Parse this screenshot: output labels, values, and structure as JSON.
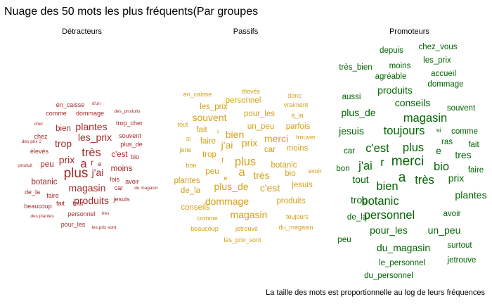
{
  "chart_data": {
    "type": "wordcloud",
    "title": "Nuage des 50 mots les plus fréquents(Par groupes",
    "caption": "La taille des mots est proportionnelle au log de leurs fréquences",
    "groups": [
      {
        "name": "Détracteurs",
        "color": "#a52a2a",
        "words": [
          {
            "text": "en_caisse",
            "weight": 2
          },
          {
            "text": "d'un",
            "weight": 1
          },
          {
            "text": "comme",
            "weight": 2
          },
          {
            "text": "dommage",
            "weight": 2
          },
          {
            "text": "des_produits",
            "weight": 1
          },
          {
            "text": "cher",
            "weight": 1
          },
          {
            "text": "plantes",
            "weight": 4
          },
          {
            "text": "trop_cher",
            "weight": 2
          },
          {
            "text": "bien",
            "weight": 3
          },
          {
            "text": "les_prix",
            "weight": 4
          },
          {
            "text": "chez",
            "weight": 2
          },
          {
            "text": "des prix 2",
            "weight": 1
          },
          {
            "text": "trop",
            "weight": 4
          },
          {
            "text": "souvent",
            "weight": 2
          },
          {
            "text": "plus_de",
            "weight": 2
          },
          {
            "text": "élevés",
            "weight": 2
          },
          {
            "text": "très",
            "weight": 5
          },
          {
            "text": "c'est",
            "weight": 3
          },
          {
            "text": "bio",
            "weight": 2
          },
          {
            "text": "prix",
            "weight": 4
          },
          {
            "text": "produit",
            "weight": 1
          },
          {
            "text": "peu",
            "weight": 3
          },
          {
            "text": "a",
            "weight": 5
          },
          {
            "text": "r",
            "weight": 3
          },
          {
            "text": "e",
            "weight": 2
          },
          {
            "text": "moins",
            "weight": 3
          },
          {
            "text": "plus",
            "weight": 6
          },
          {
            "text": "j'ai",
            "weight": 4
          },
          {
            "text": "fois",
            "weight": 2
          },
          {
            "text": "botanic",
            "weight": 3
          },
          {
            "text": "avoir",
            "weight": 2
          },
          {
            "text": "magasin",
            "weight": 4
          },
          {
            "text": "car",
            "weight": 2
          },
          {
            "text": "du magasin",
            "weight": 1
          },
          {
            "text": "de_la",
            "weight": 2
          },
          {
            "text": "faire",
            "weight": 2
          },
          {
            "text": "jesuis",
            "weight": 2
          },
          {
            "text": "produits",
            "weight": 4
          },
          {
            "text": "beaucoup",
            "weight": 2
          },
          {
            "text": "fait",
            "weight": 2
          },
          {
            "text": "tout",
            "weight": 2
          },
          {
            "text": "personnel",
            "weight": 2
          },
          {
            "text": "des plantes",
            "weight": 1
          },
          {
            "text": "tres",
            "weight": 1
          },
          {
            "text": "pour_les",
            "weight": 2
          },
          {
            "text": "les prix sont",
            "weight": 1
          }
        ]
      },
      {
        "name": "Passifs",
        "color": "#d4a017",
        "words": [
          {
            "text": "en_caisse",
            "weight": 2
          },
          {
            "text": "élevés",
            "weight": 2
          },
          {
            "text": "personnel",
            "weight": 3
          },
          {
            "text": "donc",
            "weight": 2
          },
          {
            "text": "vraiment",
            "weight": 2
          },
          {
            "text": "les_prix",
            "weight": 3
          },
          {
            "text": "pour_les",
            "weight": 3
          },
          {
            "text": "à_la",
            "weight": 2
          },
          {
            "text": "souvent",
            "weight": 4
          },
          {
            "text": "tout",
            "weight": 2
          },
          {
            "text": "un_peu",
            "weight": 3
          },
          {
            "text": "parfois",
            "weight": 3
          },
          {
            "text": "fait",
            "weight": 3
          },
          {
            "text": "1",
            "weight": 1
          },
          {
            "text": "bien",
            "weight": 4
          },
          {
            "text": "trouver",
            "weight": 2
          },
          {
            "text": "si",
            "weight": 2
          },
          {
            "text": "faire",
            "weight": 3
          },
          {
            "text": "merci",
            "weight": 4
          },
          {
            "text": "j'ai",
            "weight": 4
          },
          {
            "text": "prix",
            "weight": 4
          },
          {
            "text": "jene",
            "weight": 2
          },
          {
            "text": "car",
            "weight": 3
          },
          {
            "text": "moins",
            "weight": 3
          },
          {
            "text": "trop",
            "weight": 3
          },
          {
            "text": "r",
            "weight": 3
          },
          {
            "text": "plus",
            "weight": 5
          },
          {
            "text": "bon",
            "weight": 2
          },
          {
            "text": "botanic",
            "weight": 3
          },
          {
            "text": "peu",
            "weight": 3
          },
          {
            "text": "a",
            "weight": 5
          },
          {
            "text": "très",
            "weight": 4
          },
          {
            "text": "bio",
            "weight": 3
          },
          {
            "text": "avoir",
            "weight": 2
          },
          {
            "text": "e",
            "weight": 2
          },
          {
            "text": "plantes",
            "weight": 3
          },
          {
            "text": "plus_de",
            "weight": 4
          },
          {
            "text": "c'est",
            "weight": 4
          },
          {
            "text": "jesuis",
            "weight": 3
          },
          {
            "text": "de_la",
            "weight": 3
          },
          {
            "text": "dommage",
            "weight": 4
          },
          {
            "text": "produits",
            "weight": 3
          },
          {
            "text": "conseils",
            "weight": 3
          },
          {
            "text": "magasin",
            "weight": 4
          },
          {
            "text": "comme",
            "weight": 2
          },
          {
            "text": "toujours",
            "weight": 2
          },
          {
            "text": "beaucoup",
            "weight": 2
          },
          {
            "text": "jetrouve",
            "weight": 2
          },
          {
            "text": "du_magasin",
            "weight": 2
          },
          {
            "text": "les_prix_sont",
            "weight": 2
          }
        ]
      },
      {
        "name": "Promoteurs",
        "color": "#006400",
        "words": [
          {
            "text": "depuis",
            "weight": 3
          },
          {
            "text": "chez_vous",
            "weight": 3
          },
          {
            "text": "les_prix",
            "weight": 3
          },
          {
            "text": "très_bien",
            "weight": 3
          },
          {
            "text": "moins",
            "weight": 3
          },
          {
            "text": "accueil",
            "weight": 3
          },
          {
            "text": "agréable",
            "weight": 3
          },
          {
            "text": "dommage",
            "weight": 3
          },
          {
            "text": "aussi",
            "weight": 3
          },
          {
            "text": "produits",
            "weight": 4
          },
          {
            "text": "conseils",
            "weight": 4
          },
          {
            "text": "souvent",
            "weight": 3
          },
          {
            "text": "plus_de",
            "weight": 4
          },
          {
            "text": "magasin",
            "weight": 5
          },
          {
            "text": "jesuis",
            "weight": 4
          },
          {
            "text": "toujours",
            "weight": 5
          },
          {
            "text": "si",
            "weight": 2
          },
          {
            "text": "comme",
            "weight": 3
          },
          {
            "text": "ras",
            "weight": 3
          },
          {
            "text": "fait",
            "weight": 3
          },
          {
            "text": "car",
            "weight": 3
          },
          {
            "text": "c'est",
            "weight": 5
          },
          {
            "text": "plus",
            "weight": 5
          },
          {
            "text": "e",
            "weight": 4
          },
          {
            "text": "tres",
            "weight": 4
          },
          {
            "text": "r",
            "weight": 5
          },
          {
            "text": "merci",
            "weight": 6
          },
          {
            "text": "bon",
            "weight": 3
          },
          {
            "text": "j'ai",
            "weight": 5
          },
          {
            "text": "bio",
            "weight": 5
          },
          {
            "text": "faire",
            "weight": 3
          },
          {
            "text": "prix",
            "weight": 4
          },
          {
            "text": "tout",
            "weight": 4
          },
          {
            "text": "a",
            "weight": 6
          },
          {
            "text": "très",
            "weight": 5
          },
          {
            "text": "bien",
            "weight": 5
          },
          {
            "text": "plantes",
            "weight": 4
          },
          {
            "text": "trop",
            "weight": 4
          },
          {
            "text": "botanic",
            "weight": 5
          },
          {
            "text": "de_la",
            "weight": 3
          },
          {
            "text": "personnel",
            "weight": 5
          },
          {
            "text": "avoir",
            "weight": 3
          },
          {
            "text": "pour_les",
            "weight": 4
          },
          {
            "text": "un_peu",
            "weight": 4
          },
          {
            "text": "peu",
            "weight": 3
          },
          {
            "text": "surtout",
            "weight": 3
          },
          {
            "text": "du_magasin",
            "weight": 4
          },
          {
            "text": "le_personnel",
            "weight": 3
          },
          {
            "text": "jetrouve",
            "weight": 3
          },
          {
            "text": "du_personnel",
            "weight": 3
          }
        ]
      }
    ]
  }
}
